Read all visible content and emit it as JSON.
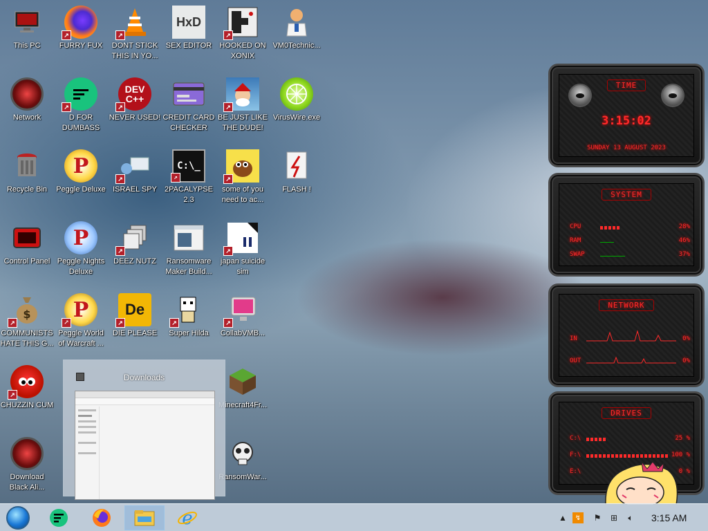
{
  "desktop": {
    "icons": [
      {
        "label": "This PC",
        "icon": "monitor-icon"
      },
      {
        "label": "FURRY FUX",
        "icon": "firefox-icon"
      },
      {
        "label": "DONT STICK THIS IN YO...",
        "icon": "vlc-cone-icon"
      },
      {
        "label": "SEX EDITOR",
        "icon": "hxd-editor-icon"
      },
      {
        "label": "HOOKED ON XONIX",
        "icon": "xonix-game-icon"
      },
      {
        "label": "VM0Technic...",
        "icon": "doctor-icon"
      },
      {
        "label": "Network",
        "icon": "red-orb-network-icon"
      },
      {
        "label": "D FOR DUMBASS",
        "icon": "green-chat-icon"
      },
      {
        "label": "NEVER USED!",
        "icon": "devcpp-icon"
      },
      {
        "label": "CREDIT CARD CHECKER",
        "icon": "credit-card-icon"
      },
      {
        "label": "BE JUST LIKE THE DUDE!",
        "icon": "santa-avatar-icon"
      },
      {
        "label": "VirusWire.exe",
        "icon": "lime-icon"
      },
      {
        "label": "Recycle Bin",
        "icon": "recycle-bin-icon"
      },
      {
        "label": "Peggle Deluxe",
        "icon": "peggle-icon"
      },
      {
        "label": "ISRAEL SPY",
        "icon": "spy-network-icon"
      },
      {
        "label": "2PACALYPSE 2.3",
        "icon": "terminal-icon"
      },
      {
        "label": "some of you need to ac...",
        "icon": "brown-dog-icon"
      },
      {
        "label": "FLASH !",
        "icon": "flash-icon"
      },
      {
        "label": "Control Panel",
        "icon": "control-panel-icon"
      },
      {
        "label": "Peggle Nights Deluxe",
        "icon": "peggle-nights-icon"
      },
      {
        "label": "DEEZ NUTZ",
        "icon": "stacked-windows-icon"
      },
      {
        "label": "Ransomware Maker Build...",
        "icon": "window-app-icon"
      },
      {
        "label": "japan suicide sim",
        "icon": "japan-sim-icon"
      },
      {
        "label": "COMMUNISTS HATE THIS G...",
        "icon": "money-bag-icon"
      },
      {
        "label": "Peggle World of Warcraft ...",
        "icon": "peggle-wow-icon"
      },
      {
        "label": "DIE PLEASE",
        "icon": "de-icon"
      },
      {
        "label": "Super Hilda",
        "icon": "pixel-character-icon"
      },
      {
        "label": "CollabVMB...",
        "icon": "pink-monitor-icon"
      },
      {
        "label": "CHUZZIN CUM",
        "icon": "red-chuzzle-icon"
      },
      {
        "label": "Minecraft4Fr...",
        "icon": "minecraft-grass-icon"
      },
      {
        "label": "Download Black Ali...",
        "icon": "red-orb-download-icon"
      },
      {
        "label": "RansomWar...",
        "icon": "skull-icon"
      }
    ]
  },
  "widget": {
    "time_title": "TIME",
    "time": "3:15:02",
    "date": "SUNDAY 13 AUGUST 2023",
    "system_title": "SYSTEM",
    "system": [
      {
        "label": "CPU",
        "value": "28%",
        "level": 0.28
      },
      {
        "label": "RAM",
        "value": "46%",
        "level": 0.46
      },
      {
        "label": "SWAP",
        "value": "37%",
        "level": 0.37
      }
    ],
    "network_title": "NETWORK",
    "network": [
      {
        "label": "IN",
        "value": "0%"
      },
      {
        "label": "OUT",
        "value": "0%"
      }
    ],
    "drives_title": "DRIVES",
    "drives": [
      {
        "label": "C:\\",
        "value": "25 %",
        "level": 0.25
      },
      {
        "label": "F:\\",
        "value": "100 %",
        "level": 1.0
      },
      {
        "label": "E:\\",
        "value": "0 %",
        "level": 0.0
      }
    ],
    "colors": {
      "accent": "#ff2a2a",
      "frame": "#4a4a4a"
    }
  },
  "thumbnail": {
    "title": "Downloads"
  },
  "taskbar": {
    "start_icon": "start-orb-icon",
    "pinned": [
      {
        "icon": "green-chat-icon"
      },
      {
        "icon": "firefox-icon"
      },
      {
        "icon": "file-explorer-icon"
      },
      {
        "icon": "internet-explorer-icon"
      }
    ],
    "tray": [
      "chevron-up-icon",
      "update-icon",
      "flag-icon",
      "network-icon",
      "volume-icon"
    ],
    "clock": "3:15 AM"
  }
}
